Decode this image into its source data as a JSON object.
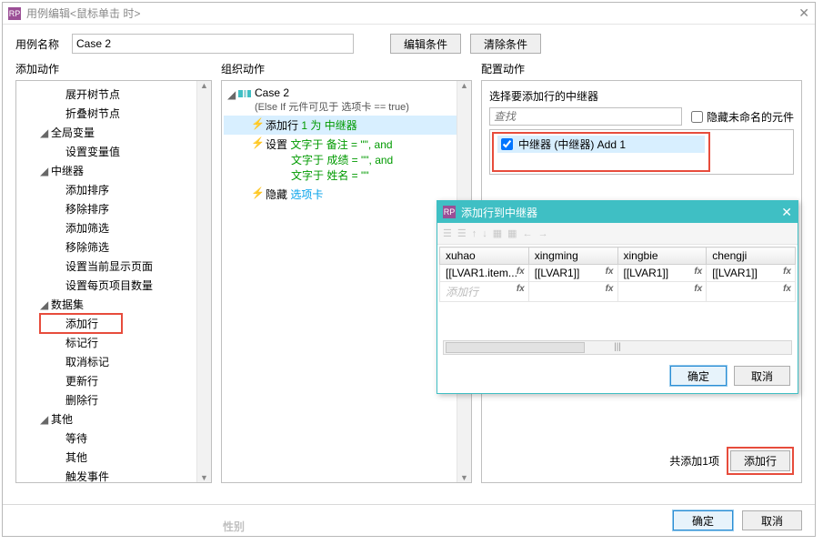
{
  "window": {
    "logo_text": "RP",
    "title": "用例编辑<鼠标单击 时>",
    "close_glyph": "✕"
  },
  "name_row": {
    "label": "用例名称",
    "value": "Case 2",
    "btn_edit": "编辑条件",
    "btn_clear": "清除条件"
  },
  "col_labels": {
    "add": "添加动作",
    "org": "组织动作",
    "cfg": "配置动作"
  },
  "tree": {
    "expand_tree": "展开树节点",
    "collapse_tree": "折叠树节点",
    "globals": "全局变量",
    "set_var": "设置变量值",
    "repeater": "中继器",
    "add_sort": "添加排序",
    "remove_sort": "移除排序",
    "add_filter": "添加筛选",
    "remove_filter": "移除筛选",
    "set_page": "设置当前显示页面",
    "set_page_count": "设置每页项目数量",
    "dataset": "数据集",
    "add_row": "添加行",
    "mark_row": "标记行",
    "unmark": "取消标记",
    "update_row": "更新行",
    "delete_row": "删除行",
    "other": "其他",
    "wait": "等待",
    "other2": "其他",
    "fire_event": "触发事件"
  },
  "case_panel": {
    "title": "Case 2",
    "subtitle": "(Else If 元件可见于 选项卡 == true)",
    "action1_pre": "添加行",
    "action1_mid": "1 为",
    "action1_suf": "中继器",
    "action2_pre": "设置",
    "action2_l1": "文字于 备注 = \"\", and",
    "action2_l2": "文字于 成绩 = \"\", and",
    "action2_l3": "文字于 姓名 = \"\"",
    "action3_pre": "隐藏",
    "action3_suf": "选项卡"
  },
  "config": {
    "select_label": "选择要添加行的中继器",
    "search_placeholder": "查找",
    "hide_unnamed": "隐藏未命名的元件",
    "item_label": "中继器 (中继器) Add 1",
    "footer_txt": "共添加1项",
    "footer_btn": "添加行"
  },
  "main_footer": {
    "ok": "确定",
    "cancel": "取消"
  },
  "subdlg": {
    "title": "添加行到中继器",
    "close_glyph": "✕",
    "columns": [
      "xuhao",
      "xingming",
      "xingbie",
      "chengji"
    ],
    "row1": [
      "[[LVAR1.item...",
      "[[LVAR1]]",
      "[[LVAR1]]",
      "[[LVAR1]]"
    ],
    "ghost": "添加行",
    "scroll_mark": "|||",
    "ok": "确定",
    "cancel": "取消"
  },
  "bottom_crop": "性别"
}
